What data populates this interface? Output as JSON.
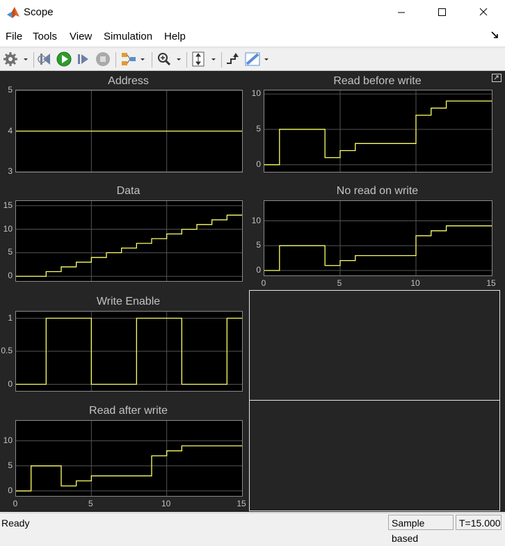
{
  "window": {
    "title": "Scope"
  },
  "menubar": {
    "items": [
      "File",
      "Tools",
      "View",
      "Simulation",
      "Help"
    ]
  },
  "toolbar": {
    "icons": [
      "gear-icon",
      "dropdown-arrow",
      "step-back-icon",
      "run-icon",
      "step-forward-icon",
      "stop-icon",
      "signal-selector-icon",
      "dropdown-arrow",
      "zoom-in-icon",
      "dropdown-arrow",
      "autoscale-icon",
      "dropdown-arrow",
      "highlight-block-icon",
      "measure-ruler-icon",
      "dropdown-arrow"
    ]
  },
  "colors": {
    "trace": "#ffff66",
    "axes_bg": "#000000",
    "figure_bg": "#252525",
    "grid": "#555555"
  },
  "chart_data": [
    {
      "type": "line",
      "step": true,
      "title": "Address",
      "xlim": [
        0,
        15
      ],
      "ylim": [
        3,
        5
      ],
      "yticks": [
        3,
        4,
        5
      ],
      "xticks": [],
      "x": [
        0,
        15
      ],
      "y": [
        4,
        4
      ]
    },
    {
      "type": "line",
      "step": true,
      "title": "Read before write",
      "xlim": [
        0,
        15
      ],
      "ylim": [
        -1,
        10.5
      ],
      "yticks": [
        0,
        5,
        10
      ],
      "xticks": [],
      "x": [
        0,
        1,
        3,
        4,
        5,
        6,
        9,
        10,
        11,
        12,
        13,
        14,
        15
      ],
      "y": [
        0,
        5,
        5,
        1,
        2,
        3,
        3,
        7,
        8,
        9,
        9,
        9,
        9
      ]
    },
    {
      "type": "line",
      "step": true,
      "title": "Data",
      "xlim": [
        0,
        15
      ],
      "ylim": [
        -1,
        16
      ],
      "yticks": [
        0,
        5,
        10,
        15
      ],
      "xticks": [],
      "x": [
        0,
        1,
        2,
        3,
        4,
        5,
        6,
        7,
        8,
        9,
        10,
        11,
        12,
        13,
        14,
        15
      ],
      "y": [
        0,
        0,
        1,
        2,
        3,
        4,
        5,
        6,
        7,
        8,
        9,
        10,
        11,
        12,
        13,
        13
      ]
    },
    {
      "type": "line",
      "step": true,
      "title": "No read on write",
      "xlim": [
        0,
        15
      ],
      "ylim": [
        -1,
        14
      ],
      "yticks": [
        0,
        5,
        10
      ],
      "xticks": [
        0,
        5,
        10,
        15
      ],
      "x": [
        0,
        1,
        3,
        4,
        5,
        6,
        9,
        10,
        11,
        12,
        13,
        14,
        15
      ],
      "y": [
        0,
        5,
        5,
        1,
        2,
        3,
        3,
        7,
        8,
        9,
        9,
        9,
        9
      ]
    },
    {
      "type": "line",
      "step": true,
      "title": "Write Enable",
      "xlim": [
        0,
        15
      ],
      "ylim": [
        -0.1,
        1.1
      ],
      "yticks": [
        0,
        0.5,
        1
      ],
      "xticks": [],
      "x": [
        0,
        1,
        2,
        3,
        4,
        5,
        6,
        7,
        8,
        9,
        10,
        11,
        12,
        13,
        14,
        15
      ],
      "y": [
        0,
        0,
        1,
        1,
        1,
        0,
        0,
        0,
        1,
        1,
        1,
        0,
        0,
        0,
        1,
        1
      ]
    },
    {
      "type": "line",
      "step": true,
      "title": "Read after write",
      "xlim": [
        0,
        15
      ],
      "ylim": [
        -1,
        14
      ],
      "yticks": [
        0,
        5,
        10
      ],
      "xticks": [
        0,
        5,
        10,
        15
      ],
      "x": [
        0,
        1,
        3,
        4,
        5,
        9,
        10,
        11,
        12,
        13,
        14,
        15
      ],
      "y": [
        0,
        5,
        1,
        2,
        3,
        7,
        8,
        9,
        9,
        9,
        9,
        9
      ]
    }
  ],
  "status": {
    "ready": "Ready",
    "mode": "Sample based",
    "time": "T=15.000"
  }
}
